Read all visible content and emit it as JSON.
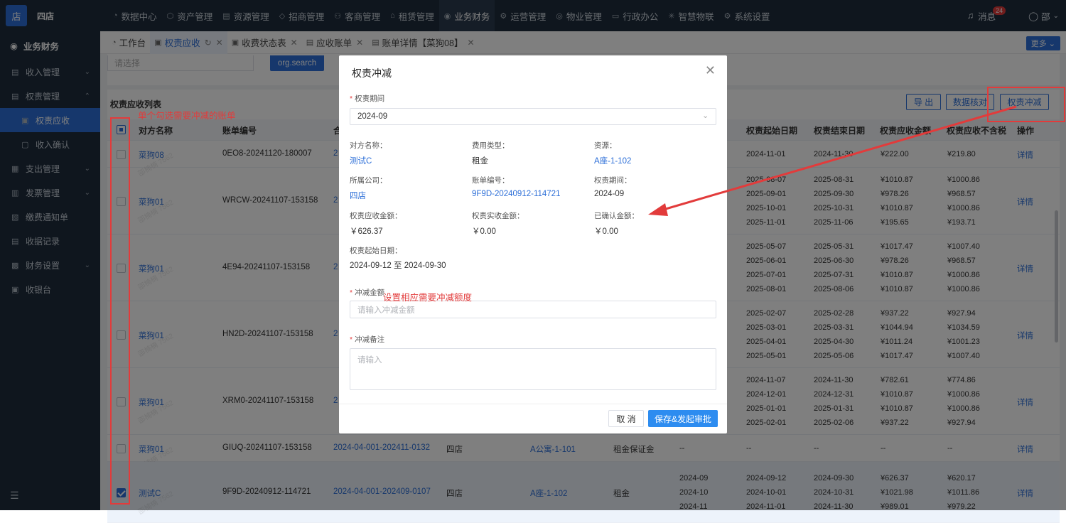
{
  "topbar": {
    "logo_text": "店",
    "org_name": "四店",
    "nav": [
      {
        "icon": "◔",
        "label": "数据中心"
      },
      {
        "icon": "⬡",
        "label": "资产管理"
      },
      {
        "icon": "▤",
        "label": "资源管理"
      },
      {
        "icon": "◇",
        "label": "招商管理"
      },
      {
        "icon": "⚇",
        "label": "客商管理"
      },
      {
        "icon": "⌂",
        "label": "租赁管理"
      },
      {
        "icon": "◉",
        "label": "业务财务",
        "active": true
      },
      {
        "icon": "⚙",
        "label": "运营管理"
      },
      {
        "icon": "◎",
        "label": "物业管理"
      },
      {
        "icon": "▭",
        "label": "行政办公"
      },
      {
        "icon": "✳",
        "label": "智慧物联"
      },
      {
        "icon": "⚙",
        "label": "系统设置"
      }
    ],
    "message_label": "消息",
    "message_count": "24",
    "user_label": "邵"
  },
  "sidebar": {
    "header": "业务财务",
    "items": [
      {
        "label": "收入管理",
        "icon": "▤",
        "chev": "⌄"
      },
      {
        "label": "权责管理",
        "icon": "▤",
        "chev": "⌃"
      },
      {
        "label": "权责应收",
        "icon": "▣",
        "sub": true,
        "active": true
      },
      {
        "label": "收入确认",
        "icon": "▢",
        "sub": true
      },
      {
        "label": "支出管理",
        "icon": "▦",
        "chev": "⌄"
      },
      {
        "label": "发票管理",
        "icon": "▥",
        "chev": "⌄"
      },
      {
        "label": "缴费通知单",
        "icon": "▧",
        "chev": ""
      },
      {
        "label": "收据记录",
        "icon": "▤",
        "chev": ""
      },
      {
        "label": "财务设置",
        "icon": "▩",
        "chev": "⌄"
      },
      {
        "label": "收银台",
        "icon": "▣",
        "chev": ""
      }
    ],
    "footer_icon": "☰"
  },
  "tabs": [
    {
      "icon": "◔",
      "label": "工作台"
    },
    {
      "icon": "▣",
      "label": "权责应收",
      "active": true,
      "refresh": "↻",
      "close": "✕"
    },
    {
      "icon": "▣",
      "label": "收费状态表",
      "close": "✕"
    },
    {
      "icon": "▤",
      "label": "应收账单",
      "close": "✕"
    },
    {
      "icon": "▤",
      "label": "账单详情【菜狗08】",
      "close": "✕"
    }
  ],
  "more_button": "更多 ⌄",
  "filter": {
    "select_placeholder": "请选择",
    "search_button": "org.search"
  },
  "list": {
    "title": "权责应收列表",
    "buttons": {
      "export": "导 出",
      "verify": "数据核对",
      "offset": "权责冲减"
    },
    "columns": [
      "对方名称",
      "账单编号",
      "合",
      "权责起始日期",
      "权责结束日期",
      "权责应收金额",
      "权责应收不含税",
      "操作"
    ],
    "rows": [
      {
        "name": "菜狗08",
        "bill": "0EO8-20241120-180007",
        "contract": "2",
        "start": [
          "2024-11-01"
        ],
        "end": [
          "2024-11-30"
        ],
        "amount": [
          "¥222.00"
        ],
        "net": [
          "¥219.80"
        ],
        "op": "详情"
      },
      {
        "name": "菜狗01",
        "bill": "WRCW-20241107-153158",
        "contract": "2",
        "start": [
          "2025-08-07",
          "2025-09-01",
          "2025-10-01",
          "2025-11-01"
        ],
        "end": [
          "2025-08-31",
          "2025-09-30",
          "2025-10-31",
          "2025-11-06"
        ],
        "amount": [
          "¥1010.87",
          "¥978.26",
          "¥1010.87",
          "¥195.65"
        ],
        "net": [
          "¥1000.86",
          "¥968.57",
          "¥1000.86",
          "¥193.71"
        ],
        "op": "详情"
      },
      {
        "name": "菜狗01",
        "bill": "4E94-20241107-153158",
        "contract": "2",
        "start": [
          "2025-05-07",
          "2025-06-01",
          "2025-07-01",
          "2025-08-01"
        ],
        "end": [
          "2025-05-31",
          "2025-06-30",
          "2025-07-31",
          "2025-08-06"
        ],
        "amount": [
          "¥1017.47",
          "¥978.26",
          "¥1010.87",
          "¥1010.87"
        ],
        "net": [
          "¥1007.40",
          "¥968.57",
          "¥1000.86",
          "¥1000.86"
        ],
        "op": "详情"
      },
      {
        "name": "菜狗01",
        "bill": "HN2D-20241107-153158",
        "contract": "2",
        "start": [
          "2025-02-07",
          "2025-03-01",
          "2025-04-01",
          "2025-05-01"
        ],
        "end": [
          "2025-02-28",
          "2025-03-31",
          "2025-04-30",
          "2025-05-06"
        ],
        "amount": [
          "¥937.22",
          "¥1044.94",
          "¥1011.24",
          "¥1017.47"
        ],
        "net": [
          "¥927.94",
          "¥1034.59",
          "¥1001.23",
          "¥1007.40"
        ],
        "op": "详情"
      },
      {
        "name": "菜狗01",
        "bill": "XRM0-20241107-153158",
        "contract": "2",
        "start": [
          "2024-11-07",
          "2024-12-01",
          "2025-01-01",
          "2025-02-01"
        ],
        "end": [
          "2024-11-30",
          "2024-12-31",
          "2025-01-31",
          "2025-02-06"
        ],
        "amount": [
          "¥782.61",
          "¥1010.87",
          "¥1010.87",
          "¥937.22"
        ],
        "net": [
          "¥774.86",
          "¥1000.86",
          "¥1000.86",
          "¥927.94"
        ],
        "op": "详情"
      },
      {
        "name": "菜狗01",
        "bill": "GIUQ-20241107-153158",
        "contract": "2024-04-001-202411-0132",
        "shop": "四店",
        "resource": "A公寓-1-101",
        "fee": "租金保证金",
        "period": [
          "--"
        ],
        "start": [
          "--"
        ],
        "end": [
          "--"
        ],
        "amount": [
          "--"
        ],
        "net": [
          "--"
        ],
        "op": "详情"
      },
      {
        "name": "测试C",
        "bill": "9F9D-20240912-114721",
        "contract": "2024-04-001-202409-0107",
        "shop": "四店",
        "resource": "A座-1-102",
        "fee": "租金",
        "period": [
          "2024-09",
          "2024-10",
          "2024-11"
        ],
        "start": [
          "2024-09-12",
          "2024-10-01",
          "2024-11-01"
        ],
        "end": [
          "2024-09-30",
          "2024-10-31",
          "2024-11-30"
        ],
        "amount": [
          "¥626.37",
          "¥1021.98",
          "¥989.01"
        ],
        "net": [
          "¥620.17",
          "¥1011.86",
          "¥979.22"
        ],
        "op": "详情",
        "checked": true
      }
    ],
    "watermark": "邵楠楠 7562"
  },
  "modal": {
    "title": "权责冲减",
    "close": "✕",
    "period_label": "权责期间",
    "period_value": "2024-09",
    "period_chevron": "⌄",
    "fields": {
      "counterparty_label": "对方名称：",
      "counterparty": "测试C",
      "fee_type_label": "费用类型：",
      "fee_type": "租金",
      "resource_label": "资源：",
      "resource": "A座-1-102",
      "company_label": "所属公司：",
      "company": "四店",
      "bill_label": "账单编号：",
      "bill": "9F9D-20240912-114721",
      "period2_label": "权责期间：",
      "period2": "2024-09",
      "receivable_label": "权责应收金额：",
      "receivable": "￥626.37",
      "received_label": "权责实收金额：",
      "received": "￥0.00",
      "confirmed_label": "已确认金额：",
      "confirmed": "￥0.00",
      "start_label": "权责起始日期：",
      "start_range": "2024-09-12 至 2024-09-30"
    },
    "offset_label": "冲减金额",
    "offset_placeholder": "请输入冲减金额",
    "remark_label": "冲减备注",
    "remark_placeholder": "请输入",
    "cancel": "取 消",
    "submit": "保存&发起审批"
  },
  "annotations": {
    "select_note": "单个勾选需要冲减的账单",
    "amount_note": "设置相应需要冲减额度"
  },
  "colors": {
    "accent": "#2d6fd8",
    "nav_bg": "#1f2d3d",
    "annotation": "#e23b3b"
  }
}
